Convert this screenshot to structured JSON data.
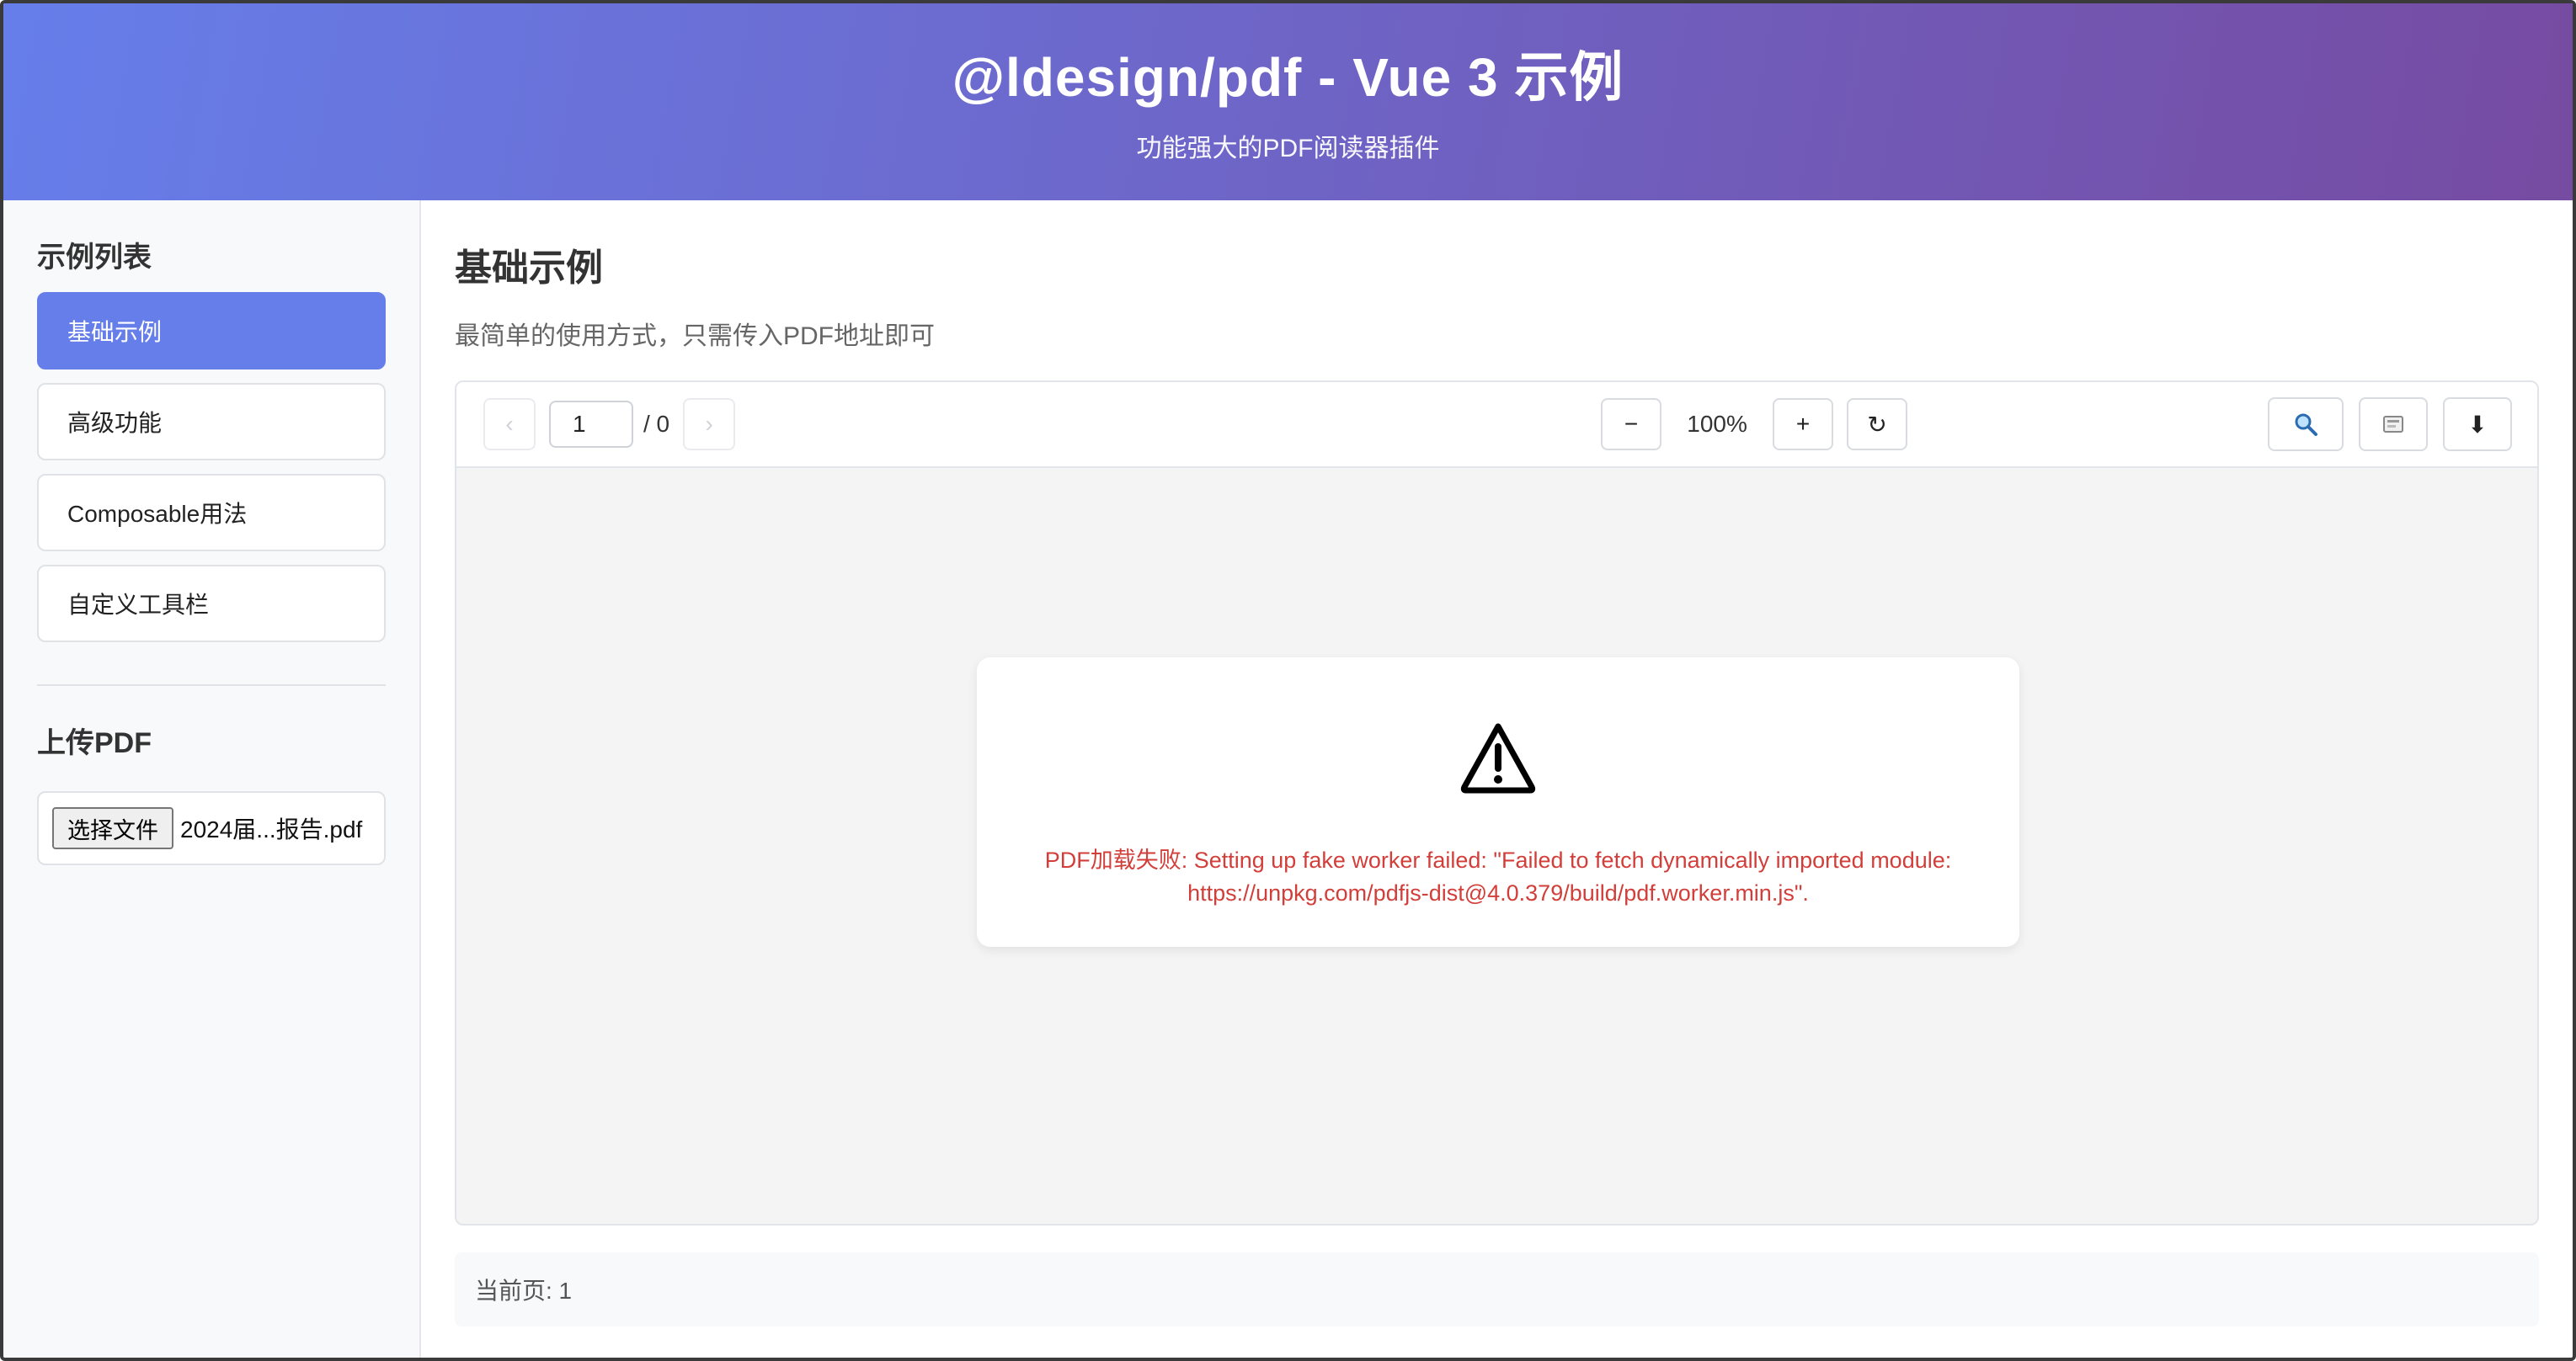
{
  "header": {
    "title": "@ldesign/pdf - Vue 3 示例",
    "subtitle": "功能强大的PDF阅读器插件"
  },
  "sidebar": {
    "examples_title": "示例列表",
    "items": [
      {
        "label": "基础示例",
        "active": true
      },
      {
        "label": "高级功能",
        "active": false
      },
      {
        "label": "Composable用法",
        "active": false
      },
      {
        "label": "自定义工具栏",
        "active": false
      }
    ],
    "upload_title": "上传PDF",
    "file_button": "选择文件",
    "file_name": "2024届...报告.pdf"
  },
  "main": {
    "title": "基础示例",
    "description": "最简单的使用方式，只需传入PDF地址即可"
  },
  "toolbar": {
    "prev_glyph": "‹",
    "next_glyph": "›",
    "page_value": "1",
    "page_total": "/ 0",
    "zoom_out_glyph": "−",
    "zoom_level": "100%",
    "zoom_in_glyph": "+",
    "rotate_glyph": "↻",
    "search_icon": "magnifier-icon",
    "thumbnail_icon": "image-icon",
    "download_glyph": "⬇"
  },
  "error": {
    "message": "PDF加载失败: Setting up fake worker failed: \"Failed to fetch dynamically imported module: https://unpkg.com/pdfjs-dist@4.0.379/build/pdf.worker.min.js\".",
    "color": "#d23f3a"
  },
  "status": {
    "current_page": "当前页: 1"
  },
  "colors": {
    "accent": "#667eea",
    "header_gradient_end": "#764ba2"
  }
}
